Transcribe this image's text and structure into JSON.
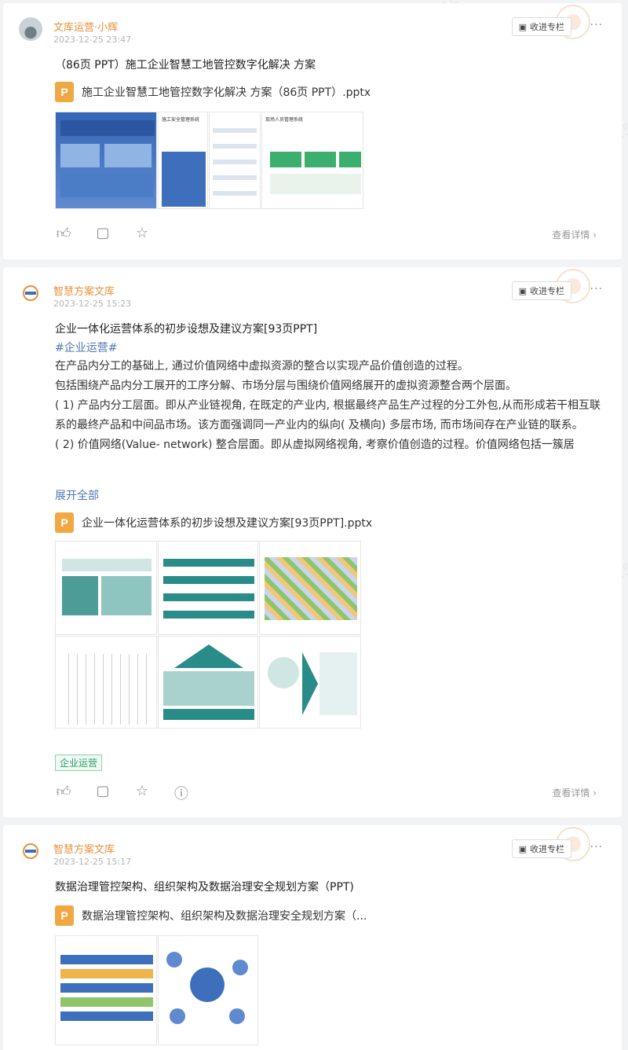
{
  "watermark": "文库运营小辉 2125441158415",
  "icons": {
    "thumb_up": "thumb-up-icon",
    "comment": "comment-icon",
    "star": "star-icon",
    "report": "report-icon",
    "collect": "collect-icon",
    "more": "more-icon",
    "file": "ppt-file-icon"
  },
  "colors": {
    "author": "#e8903a",
    "hashtag": "#4b78b0",
    "tag": "#2e9b6b",
    "file_icon": "#f0a844"
  },
  "posts": [
    {
      "author": "文库运营·小辉",
      "time": "2023-12-25 23:47",
      "collect_label": "收进专栏",
      "more_label": "···",
      "title": "（86页 PPT）施工企业智慧工地管控数字化解决 方案",
      "file_name": "施工企业智慧工地管控数字化解决 方案（86页 PPT）.pptx",
      "file_icon_letter": "P",
      "detail_label": "查看详情",
      "thumbs": [
        {
          "label": "",
          "caption": ""
        },
        {
          "label": "施工安全管理系统",
          "caption": ""
        },
        {
          "label": "现场人员管理系统",
          "caption": ""
        },
        {
          "label": "",
          "caption": ""
        }
      ]
    },
    {
      "author": "智慧方案文库",
      "time": "2023-12-25 15:23",
      "collect_label": "收进专栏",
      "more_label": "···",
      "title": "企业一体化运营体系的初步设想及建议方案[93页PPT]",
      "hashtag": "#企业运营#",
      "paragraphs": [
        "在产品内分工的基础上, 通过价值网络中虚拟资源的整合以实现产品价值创造的过程。",
        "包括围绕产品内分工展开的工序分解、市场分层与围绕价值网络展开的虚拟资源整合两个层面。",
        "( 1) 产品内分工层面。即从产业链视角, 在既定的产业内, 根据最终产品生产过程的分工外包,从而形成若干相互联系的最终产品和中间品市场。该方面强调同一产业内的纵向( 及横向) 多层市场, 而市场间存在产业链的联系。",
        "( 2) 价值网络(Value- network) 整合层面。即从虚拟网络视角, 考察价值创造的过程。价值网络包括一簇居"
      ],
      "expand_label": "展开全部",
      "file_name": "企业一体化运营体系的初步设想及建议方案[93页PPT].pptx",
      "file_icon_letter": "P",
      "tag": "企业运营",
      "detail_label": "查看详情"
    },
    {
      "author": "智慧方案文库",
      "time": "2023-12-25 15:17",
      "collect_label": "收进专栏",
      "more_label": "···",
      "title": "数据治理管控架构、组织架构及数据治理安全规划方案（PPT)",
      "file_name": "数据治理管控架构、组织架构及数据治理安全规划方案（...",
      "file_icon_letter": "P"
    }
  ]
}
